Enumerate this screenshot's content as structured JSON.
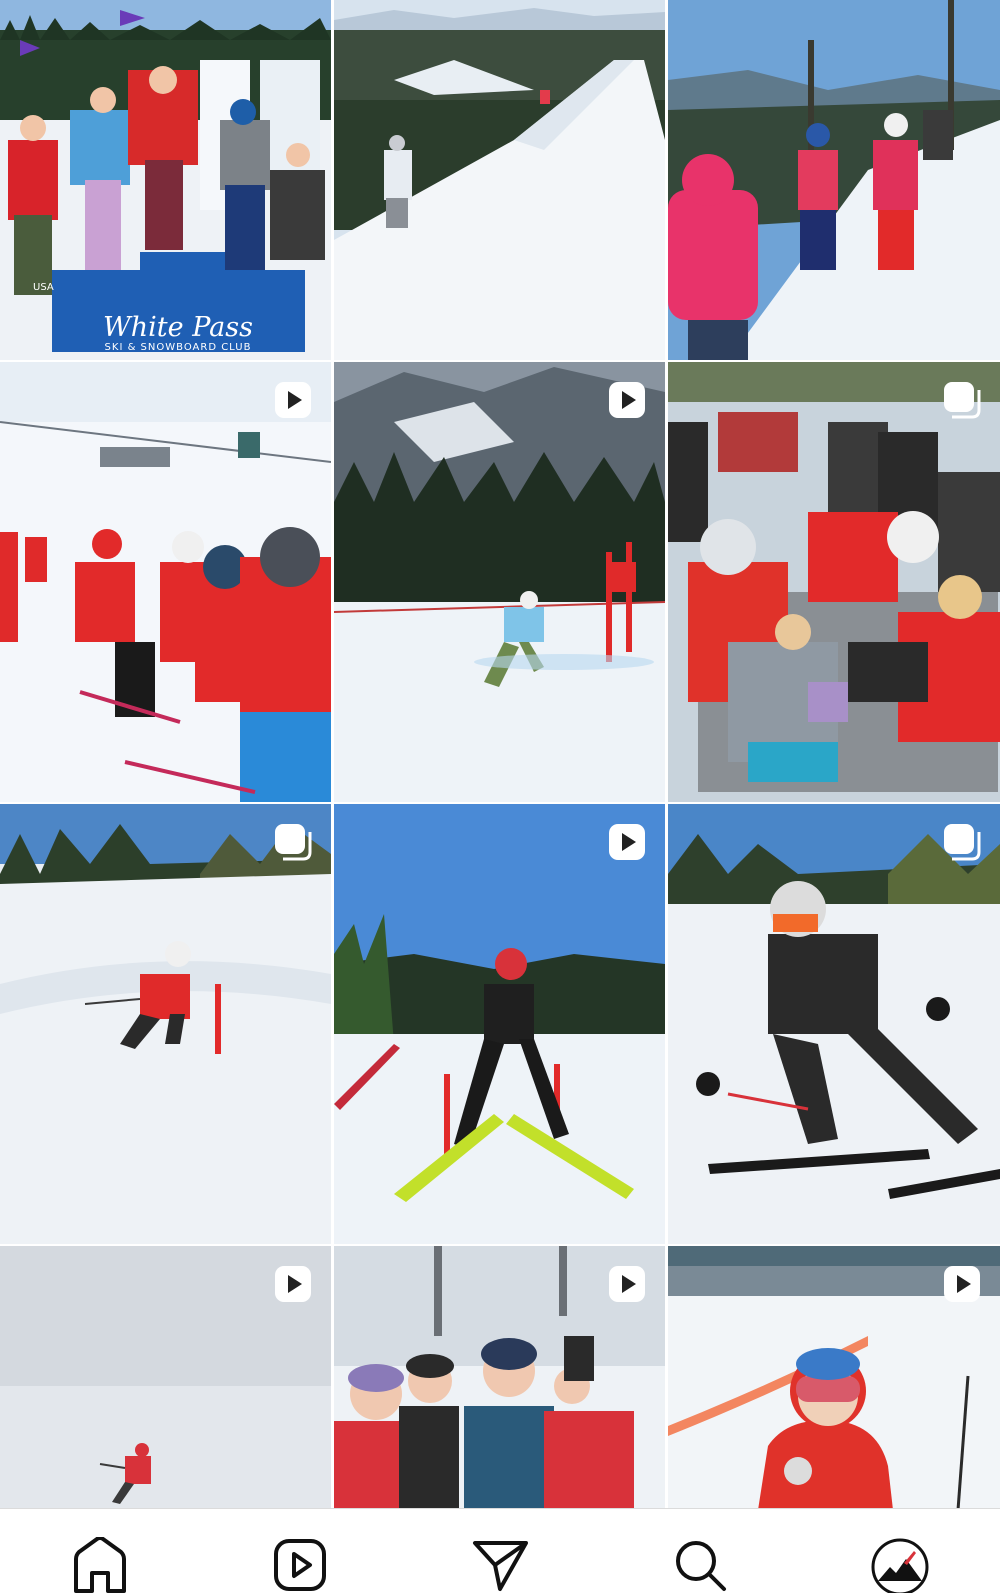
{
  "grid": {
    "posts": [
      {
        "id": "post-podium",
        "media": "image",
        "scene": "podium",
        "podium_title": "White Pass",
        "podium_subtitle": "SKI & SNOWBOARD CLUB",
        "shirt_text": "USA"
      },
      {
        "id": "post-ridge",
        "media": "image",
        "scene": "ridge"
      },
      {
        "id": "post-coaches",
        "media": "image",
        "scene": "coaches"
      },
      {
        "id": "post-group-line",
        "media": "reel",
        "scene": "group-line"
      },
      {
        "id": "post-gs-gate",
        "media": "reel",
        "scene": "gs-gate"
      },
      {
        "id": "post-picnic",
        "media": "carousel",
        "scene": "picnic"
      },
      {
        "id": "post-slalom-kid",
        "media": "carousel",
        "scene": "slalom-kid"
      },
      {
        "id": "post-skier-back",
        "media": "reel",
        "scene": "skier-back"
      },
      {
        "id": "post-skier-crouch",
        "media": "carousel",
        "scene": "skier-crouch"
      },
      {
        "id": "post-fog-skier",
        "media": "reel",
        "scene": "fog-skier"
      },
      {
        "id": "post-friends",
        "media": "reel",
        "scene": "friends"
      },
      {
        "id": "post-kid-goggles",
        "media": "reel",
        "scene": "kid-goggles"
      }
    ]
  },
  "tabbar": {
    "tabs": [
      {
        "id": "home",
        "icon": "home-icon"
      },
      {
        "id": "reels",
        "icon": "reels-icon"
      },
      {
        "id": "messages",
        "icon": "send-icon"
      },
      {
        "id": "search",
        "icon": "search-icon"
      },
      {
        "id": "profile",
        "icon": "profile-avatar-icon"
      }
    ]
  },
  "colors": {
    "snow": "#f1f4f8",
    "sky": "#4a86c8",
    "pine": "#2c3f2a",
    "ski_red": "#e02a2a",
    "podium_blue": "#1f5fb4",
    "icon": "#111111"
  }
}
